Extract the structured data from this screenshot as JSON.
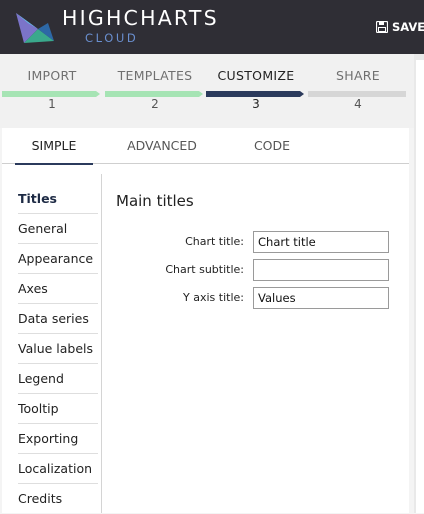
{
  "header": {
    "brand": "HIGHCHARTS",
    "brand_sub": "CLOUD",
    "save_label": "SAVE"
  },
  "stepper": {
    "steps": [
      {
        "label": "IMPORT",
        "number": "1",
        "status": "done"
      },
      {
        "label": "TEMPLATES",
        "number": "2",
        "status": "done"
      },
      {
        "label": "CUSTOMIZE",
        "number": "3",
        "status": "active"
      },
      {
        "label": "SHARE",
        "number": "4",
        "status": "todo"
      }
    ],
    "colors": {
      "done": "#a6e4b4",
      "active": "#2b3a5c",
      "todo": "#d6d6d6"
    }
  },
  "tabs": [
    {
      "label": "SIMPLE",
      "active": true
    },
    {
      "label": "ADVANCED",
      "active": false
    },
    {
      "label": "CODE",
      "active": false
    }
  ],
  "sidebar": {
    "items": [
      {
        "label": "Titles",
        "active": true
      },
      {
        "label": "General"
      },
      {
        "label": "Appearance"
      },
      {
        "label": "Axes"
      },
      {
        "label": "Data series"
      },
      {
        "label": "Value labels"
      },
      {
        "label": "Legend"
      },
      {
        "label": "Tooltip"
      },
      {
        "label": "Exporting"
      },
      {
        "label": "Localization"
      },
      {
        "label": "Credits"
      }
    ]
  },
  "main": {
    "section_title": "Main titles",
    "fields": [
      {
        "label": "Chart title:",
        "value": "Chart title"
      },
      {
        "label": "Chart subtitle:",
        "value": ""
      },
      {
        "label": "Y axis title:",
        "value": "Values"
      }
    ]
  }
}
